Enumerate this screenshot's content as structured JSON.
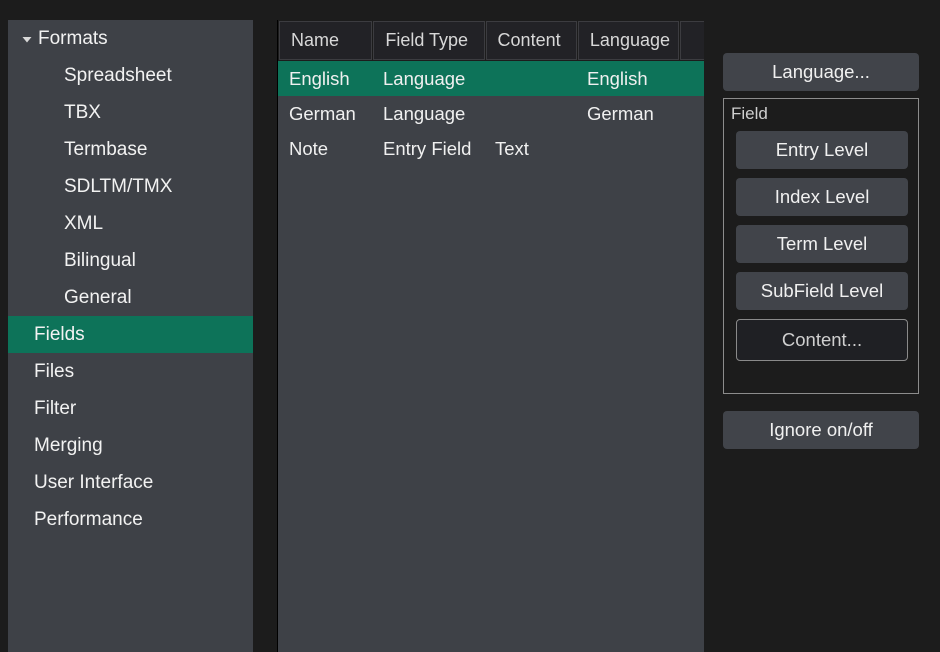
{
  "colors": {
    "background": "#1c1c1c",
    "panel": "#3e4147",
    "selection": "#0d7359",
    "button": "#41444a",
    "text": "#f0f0f0",
    "header_cell": "#222226",
    "border": "#8c8c8c"
  },
  "sidebar": {
    "items": [
      {
        "label": "Formats",
        "level": "root",
        "icon": "chevron-down-icon",
        "expanded": true,
        "selected": false
      },
      {
        "label": "Spreadsheet",
        "level": "child",
        "icon": null,
        "expanded": null,
        "selected": false
      },
      {
        "label": "TBX",
        "level": "child",
        "icon": null,
        "expanded": null,
        "selected": false
      },
      {
        "label": "Termbase",
        "level": "child",
        "icon": null,
        "expanded": null,
        "selected": false
      },
      {
        "label": "SDLTM/TMX",
        "level": "child",
        "icon": null,
        "expanded": null,
        "selected": false
      },
      {
        "label": "XML",
        "level": "child",
        "icon": null,
        "expanded": null,
        "selected": false
      },
      {
        "label": "Bilingual",
        "level": "child",
        "icon": null,
        "expanded": null,
        "selected": false
      },
      {
        "label": "General",
        "level": "child",
        "icon": null,
        "expanded": null,
        "selected": false
      },
      {
        "label": "Fields",
        "level": "flat",
        "icon": null,
        "expanded": null,
        "selected": true
      },
      {
        "label": "Files",
        "level": "flat",
        "icon": null,
        "expanded": null,
        "selected": false
      },
      {
        "label": "Filter",
        "level": "flat",
        "icon": null,
        "expanded": null,
        "selected": false
      },
      {
        "label": "Merging",
        "level": "flat",
        "icon": null,
        "expanded": null,
        "selected": false
      },
      {
        "label": "User Interface",
        "level": "flat",
        "icon": null,
        "expanded": null,
        "selected": false
      },
      {
        "label": "Performance",
        "level": "flat",
        "icon": null,
        "expanded": null,
        "selected": false
      }
    ]
  },
  "table": {
    "columns": [
      "Name",
      "Field Type",
      "Content",
      "Language",
      ""
    ],
    "rows": [
      {
        "cells": [
          "English",
          "Language",
          "",
          "English",
          ""
        ],
        "selected": true
      },
      {
        "cells": [
          "German",
          "Language",
          "",
          "German",
          ""
        ],
        "selected": false
      },
      {
        "cells": [
          "Note",
          "Entry Field",
          "Text",
          "",
          ""
        ],
        "selected": false
      }
    ]
  },
  "right_panel": {
    "language_button": "Language...",
    "field_group": {
      "title": "Field",
      "buttons": [
        {
          "label": "Entry Level",
          "style": "filled"
        },
        {
          "label": "Index Level",
          "style": "filled"
        },
        {
          "label": "Term Level",
          "style": "filled"
        },
        {
          "label": "SubField Level",
          "style": "filled"
        },
        {
          "label": "Content...",
          "style": "outlined"
        }
      ]
    },
    "ignore_button": "Ignore on/off"
  }
}
